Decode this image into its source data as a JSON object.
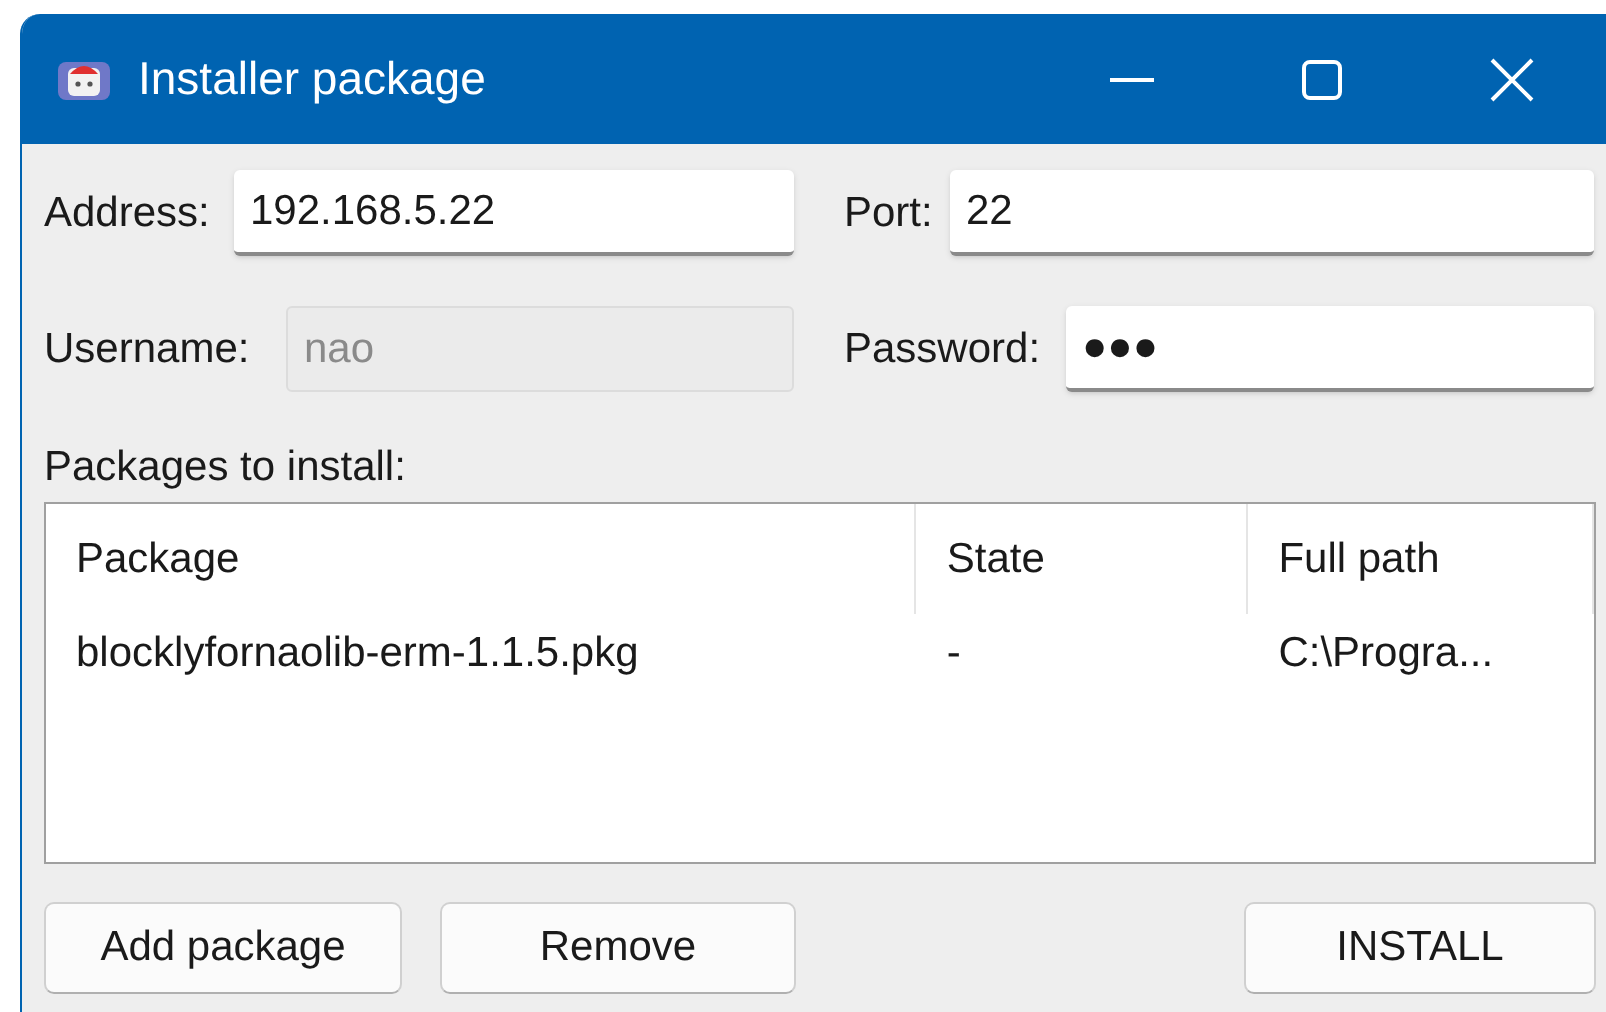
{
  "window": {
    "title": "Installer package"
  },
  "fields": [
    {
      "label": "Address:",
      "value": "192.168.5.22",
      "disabled": false
    },
    {
      "label": "Port:",
      "value": "22",
      "disabled": false
    },
    {
      "label": "Username:",
      "value": "nao",
      "disabled": true
    },
    {
      "label": "Password:",
      "value": "●●●",
      "disabled": false
    }
  ],
  "packages_label": "Packages to install:",
  "table": {
    "columns": [
      "Package",
      "State",
      "Full path"
    ],
    "rows": [
      [
        "blocklyfornaolib-erm-1.1.5.pkg",
        "-",
        "C:\\Progra..."
      ]
    ]
  },
  "buttons": [
    "Add package",
    "Remove",
    "INSTALL"
  ]
}
